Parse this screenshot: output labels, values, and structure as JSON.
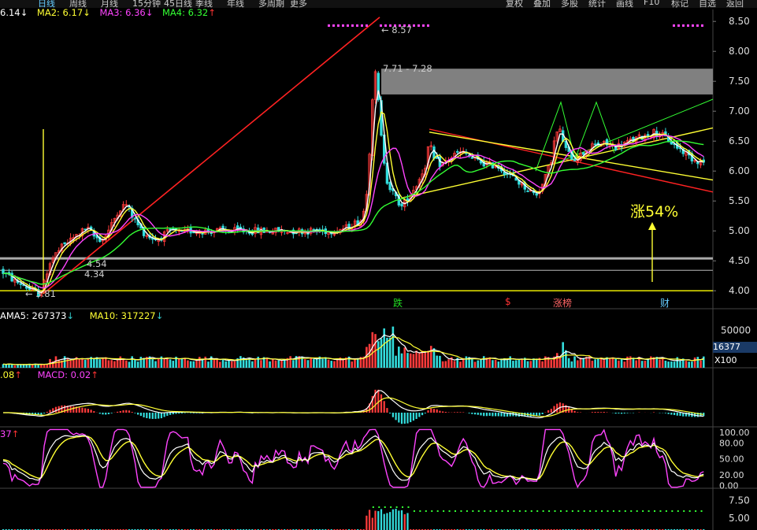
{
  "toolbar": {
    "periods": [
      "日线",
      "周线",
      "月线",
      "15分钟",
      "45日线",
      "季线",
      "年线",
      "多周期",
      "更多"
    ],
    "right_buttons": [
      "复权",
      "叠加",
      "多股",
      "统计",
      "画线",
      "F10",
      "标记",
      "自选",
      "返回"
    ]
  },
  "price_legend": {
    "ma1": "6.14",
    "ma2_label": "MA2:",
    "ma2": "6.17",
    "ma3_label": "MA3:",
    "ma3": "6.36",
    "ma4_label": "MA4:",
    "ma4": "6.32"
  },
  "volume_legend": {
    "ma5_label": "MA5:",
    "ma5": "267373",
    "ma10_label": "MA10:",
    "ma10": "317227"
  },
  "macd_legend": {
    "dea": ".08",
    "macd_label": "MACD:",
    "macd": "0.02"
  },
  "kdj_legend": {
    "value": "37"
  },
  "annotations": {
    "high": "8.57",
    "zone": "7.71 - 7.28",
    "low": "3.81",
    "lvl1": "4.54",
    "lvl2": "4.34",
    "rise": "涨54%",
    "vol_current": "16377",
    "vol_unit": "X100"
  },
  "event_markers": [
    {
      "label": "跌",
      "color": "#22dd22"
    },
    {
      "label": "$",
      "color": "#ff3333"
    },
    {
      "label": "涨榜",
      "color": "#ff6666"
    },
    {
      "label": "财",
      "color": "#66ccff"
    }
  ],
  "chart_data": [
    {
      "type": "candlestick",
      "title": "",
      "y_ticks": [
        8.5,
        8.0,
        7.5,
        7.0,
        6.5,
        6.0,
        5.5,
        5.0,
        4.5,
        4.0
      ],
      "ylim": [
        3.7,
        8.7
      ],
      "n": 240,
      "knots": [
        [
          0,
          4.35
        ],
        [
          10,
          4.25
        ],
        [
          20,
          4.15
        ],
        [
          30,
          4.1
        ],
        [
          40,
          4.0
        ],
        [
          50,
          3.95
        ],
        [
          55,
          4.05
        ],
        [
          62,
          4.45
        ],
        [
          70,
          4.6
        ],
        [
          80,
          4.75
        ],
        [
          90,
          4.85
        ],
        [
          100,
          4.95
        ],
        [
          110,
          5.05
        ],
        [
          120,
          4.9
        ],
        [
          130,
          4.85
        ],
        [
          140,
          5.05
        ],
        [
          150,
          5.35
        ],
        [
          160,
          5.45
        ],
        [
          170,
          5.2
        ],
        [
          180,
          5.0
        ],
        [
          190,
          4.9
        ],
        [
          200,
          4.85
        ],
        [
          210,
          4.95
        ],
        [
          220,
          5.0
        ],
        [
          230,
          4.95
        ],
        [
          240,
          5.0
        ],
        [
          260,
          5.0
        ],
        [
          280,
          5.0
        ],
        [
          300,
          5.0
        ],
        [
          320,
          5.0
        ],
        [
          340,
          5.0
        ],
        [
          360,
          5.0
        ],
        [
          380,
          5.0
        ],
        [
          400,
          5.0
        ],
        [
          420,
          5.0
        ],
        [
          440,
          5.05
        ],
        [
          460,
          5.2
        ],
        [
          465,
          5.6
        ],
        [
          470,
          6.5
        ],
        [
          475,
          7.8
        ],
        [
          480,
          7.2
        ],
        [
          485,
          6.4
        ],
        [
          492,
          5.8
        ],
        [
          500,
          5.6
        ],
        [
          510,
          5.4
        ],
        [
          520,
          5.6
        ],
        [
          530,
          5.8
        ],
        [
          540,
          6.1
        ],
        [
          545,
          6.5
        ],
        [
          550,
          6.2
        ],
        [
          560,
          6.1
        ],
        [
          570,
          6.2
        ],
        [
          580,
          6.3
        ],
        [
          590,
          6.3
        ],
        [
          600,
          6.2
        ],
        [
          610,
          6.15
        ],
        [
          620,
          6.1
        ],
        [
          630,
          6.1
        ],
        [
          640,
          6.0
        ],
        [
          650,
          5.9
        ],
        [
          660,
          5.8
        ],
        [
          670,
          5.7
        ],
        [
          680,
          5.6
        ],
        [
          690,
          5.8
        ],
        [
          700,
          6.2
        ],
        [
          705,
          6.6
        ],
        [
          710,
          6.7
        ],
        [
          715,
          6.5
        ],
        [
          720,
          6.3
        ],
        [
          730,
          6.2
        ],
        [
          740,
          6.3
        ],
        [
          750,
          6.4
        ],
        [
          760,
          6.45
        ],
        [
          770,
          6.45
        ],
        [
          780,
          6.4
        ],
        [
          790,
          6.45
        ],
        [
          800,
          6.5
        ],
        [
          810,
          6.55
        ],
        [
          820,
          6.6
        ],
        [
          830,
          6.65
        ],
        [
          840,
          6.6
        ],
        [
          850,
          6.5
        ],
        [
          860,
          6.4
        ],
        [
          870,
          6.3
        ],
        [
          880,
          6.2
        ],
        [
          893,
          6.15
        ]
      ],
      "h_levels": [
        {
          "value": 4.54,
          "color": "#aaaaaa"
        },
        {
          "value": 4.34,
          "color": "#888888"
        },
        {
          "value": 4.0,
          "color": "#ffff00"
        }
      ],
      "zone": [
        7.28,
        7.71
      ]
    },
    {
      "type": "bar",
      "title": "",
      "y_ticks": [
        50000
      ],
      "ylim": [
        0,
        75000
      ]
    },
    {
      "type": "line",
      "title": "",
      "series": [
        {
          "name": "MACD"
        }
      ]
    },
    {
      "type": "line",
      "title": "",
      "y_ticks": [
        100.0,
        80.0,
        50.0,
        20.0,
        0.0
      ],
      "ylim": [
        -5,
        110
      ]
    },
    {
      "type": "bar",
      "title": "",
      "y_ticks": [
        7.5,
        5.0
      ],
      "ylim": [
        0,
        10
      ]
    }
  ]
}
